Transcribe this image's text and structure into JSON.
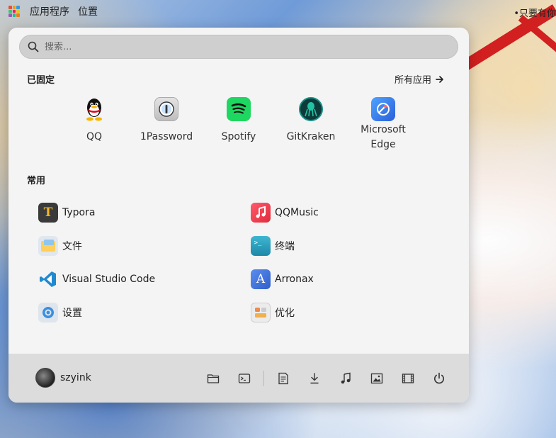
{
  "topbar": {
    "menu_apps": "应用程序",
    "menu_places": "位置",
    "right_text": "•只要有你"
  },
  "search": {
    "placeholder": "搜索..."
  },
  "pinned_section": {
    "title": "已固定",
    "all_apps_label": "所有应用",
    "apps": [
      {
        "label": "QQ",
        "icon": "qq-penguin-icon"
      },
      {
        "label": "1Password",
        "icon": "1password-icon"
      },
      {
        "label": "Spotify",
        "icon": "spotify-icon"
      },
      {
        "label": "GitKraken",
        "icon": "gitkraken-icon"
      },
      {
        "label": "Microsoft\nEdge",
        "icon": "edge-icon"
      }
    ]
  },
  "common_section": {
    "title": "常用",
    "apps": [
      {
        "label": "Typora",
        "icon": "typora-icon"
      },
      {
        "label": "QQMusic",
        "icon": "qqmusic-icon"
      },
      {
        "label": "文件",
        "icon": "files-icon"
      },
      {
        "label": "终端",
        "icon": "terminal-icon"
      },
      {
        "label": "Visual Studio Code",
        "icon": "vscode-icon"
      },
      {
        "label": "Arronax",
        "icon": "arronax-icon"
      },
      {
        "label": "设置",
        "icon": "settings-icon"
      },
      {
        "label": "优化",
        "icon": "tweaks-icon"
      }
    ]
  },
  "footer": {
    "username": "szyink",
    "buttons": [
      "folder-icon",
      "terminal-icon",
      "document-icon",
      "download-icon",
      "music-icon",
      "image-icon",
      "video-icon",
      "power-icon"
    ]
  },
  "colors": {
    "panel_bg": "#f4f4f4",
    "footer_bg": "#dcdcdc",
    "search_bg": "#cfcfcf",
    "accent_red": "#d21f1f"
  }
}
